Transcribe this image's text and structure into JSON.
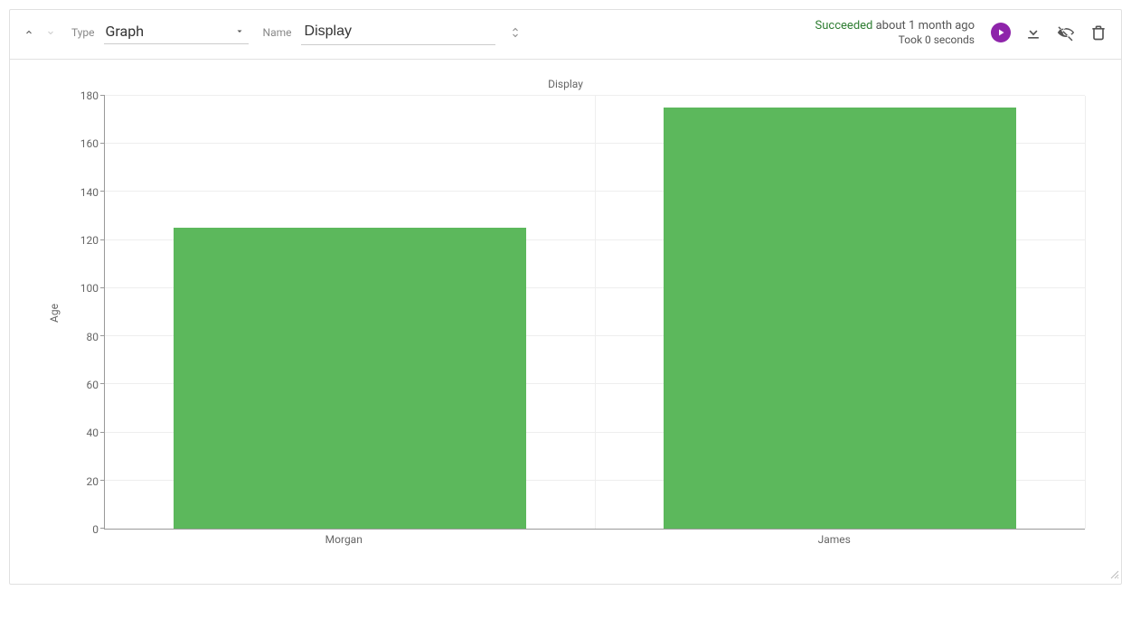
{
  "toolbar": {
    "type_label": "Type",
    "type_value": "Graph",
    "name_label": "Name",
    "name_value": "Display"
  },
  "status": {
    "state": "Succeeded",
    "when": "about 1 month ago",
    "took": "Took 0 seconds"
  },
  "chart_data": {
    "type": "bar",
    "title": "Display",
    "xlabel": "",
    "ylabel": "Age",
    "ylim": [
      0,
      180
    ],
    "yticks": [
      0,
      20,
      40,
      60,
      80,
      100,
      120,
      140,
      160,
      180
    ],
    "categories": [
      "Morgan",
      "James"
    ],
    "values": [
      125,
      175
    ],
    "bar_color": "#5cb85c"
  }
}
